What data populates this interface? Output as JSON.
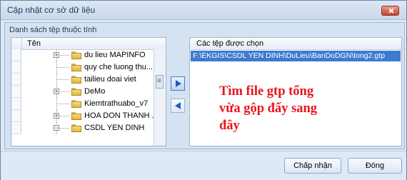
{
  "window": {
    "title": "Cập nhật cơ sở dữ liệu"
  },
  "group": {
    "title": "Danh sách tệp thuộc tính"
  },
  "left_pane": {
    "header": "Tên",
    "items": [
      {
        "label": "du lieu MAPINFO",
        "expandable": true
      },
      {
        "label": "quy che luong thu...",
        "expandable": false
      },
      {
        "label": "tailieu doai viet",
        "expandable": false
      },
      {
        "label": "DeMo",
        "expandable": true
      },
      {
        "label": "Kiemtrathuabo_v7",
        "expandable": false
      },
      {
        "label": "HOA DON THANH ...",
        "expandable": true
      },
      {
        "label": "CSDL YEN DINH",
        "expandable": true,
        "expanded": true
      }
    ]
  },
  "right_pane": {
    "header": "Các tệp được chọn",
    "files": [
      "F:\\EKGIS\\CSDL YEN DINH\\DuLieu\\BanDoDGN\\tong2.gtp"
    ]
  },
  "annotation": {
    "line1": "Tìm file gtp tổng",
    "line2": "vừa gộp đấy sang",
    "line3": "đây",
    "color": "#e8141b"
  },
  "footer": {
    "accept_label": "Chấp nhận",
    "close_label": "Đóng"
  }
}
